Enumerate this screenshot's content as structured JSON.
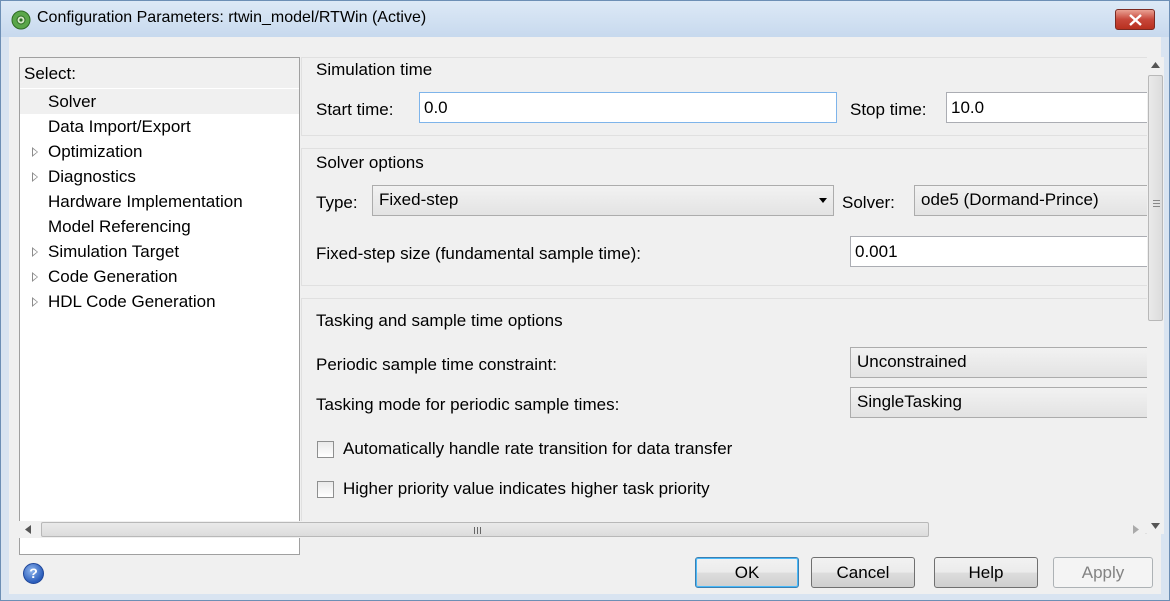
{
  "window": {
    "title": "Configuration Parameters: rtwin_model/RTWin (Active)",
    "app_icon": "gear-config-icon",
    "close_icon": "close-icon"
  },
  "tree": {
    "header": "Select:",
    "items": [
      {
        "label": "Solver",
        "expandable": false,
        "selected": true
      },
      {
        "label": "Data Import/Export",
        "expandable": false
      },
      {
        "label": "Optimization",
        "expandable": true
      },
      {
        "label": "Diagnostics",
        "expandable": true
      },
      {
        "label": "Hardware Implementation",
        "expandable": false
      },
      {
        "label": "Model Referencing",
        "expandable": false
      },
      {
        "label": "Simulation Target",
        "expandable": true
      },
      {
        "label": "Code Generation",
        "expandable": true
      },
      {
        "label": "HDL Code Generation",
        "expandable": true
      }
    ]
  },
  "simulation_time": {
    "title": "Simulation time",
    "start_label": "Start time:",
    "start_value": "0.0",
    "stop_label": "Stop time:",
    "stop_value": "10.0"
  },
  "solver_options": {
    "title": "Solver options",
    "type_label": "Type:",
    "type_value": "Fixed-step",
    "solver_label": "Solver:",
    "solver_value": "ode5 (Dormand-Prince)",
    "step_label": "Fixed-step size (fundamental sample time):",
    "step_value": "0.001"
  },
  "tasking": {
    "title": "Tasking and sample time options",
    "constraint_label": "Periodic sample time constraint:",
    "constraint_value": "Unconstrained",
    "mode_label": "Tasking mode for periodic sample times:",
    "mode_value": "SingleTasking",
    "auto_rate_label": "Automatically handle rate transition for data transfer",
    "auto_rate_checked": false,
    "priority_label": "Higher priority value indicates higher task priority",
    "priority_checked": false
  },
  "buttons": {
    "ok": "OK",
    "cancel": "Cancel",
    "help": "Help",
    "apply": "Apply",
    "help_icon": "question-icon"
  },
  "colors": {
    "titlebar": "#c7d9ee",
    "close_button": "#c7473a",
    "panel": "#f0f0f0",
    "focus_border": "#7eb4ea"
  }
}
